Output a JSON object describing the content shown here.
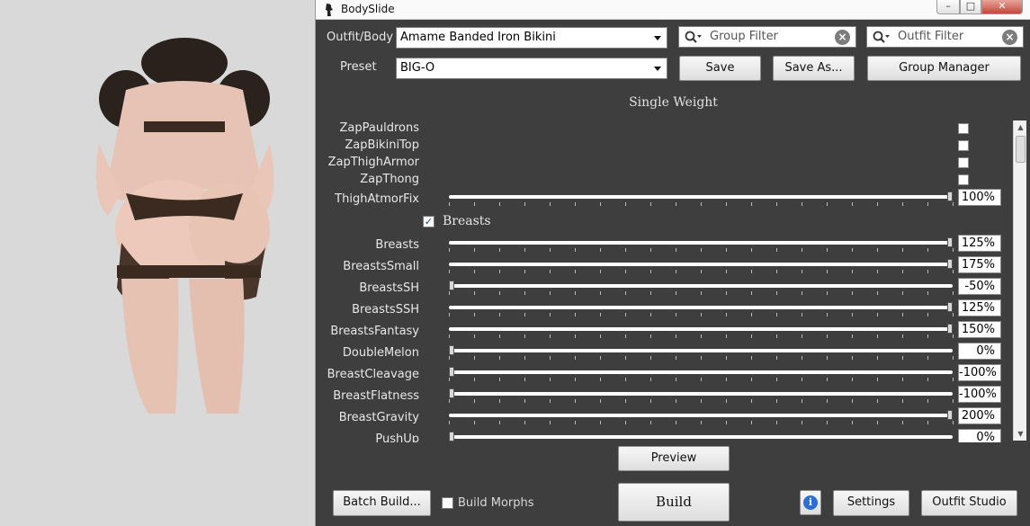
{
  "window": {
    "title": "BodySlide"
  },
  "header": {
    "outfit_label": "Outfit/Body",
    "outfit_value": "Amame Banded Iron Bikini",
    "preset_label": "Preset",
    "preset_value": "BIG-O",
    "group_filter_placeholder": "Group Filter",
    "outfit_filter_placeholder": "Outfit Filter",
    "save_label": "Save",
    "save_as_label": "Save As...",
    "group_manager_label": "Group Manager"
  },
  "single_weight_title": "Single Weight",
  "zaps": [
    {
      "label": "ZapPauldrons",
      "checked": false
    },
    {
      "label": "ZapBikiniTop",
      "checked": false
    },
    {
      "label": "ZapThighArmor",
      "checked": false
    },
    {
      "label": "ZapThong",
      "checked": false
    }
  ],
  "thigh_fix": {
    "label": "ThighAtmorFix",
    "value": "100%",
    "level": 100
  },
  "group": {
    "label": "Breasts",
    "checked": true
  },
  "sliders": [
    {
      "label": "Breasts",
      "value": "125%",
      "level": 100
    },
    {
      "label": "BreastsSmall",
      "value": "175%",
      "level": 100
    },
    {
      "label": "BreastsSH",
      "value": "-50%",
      "level": 0
    },
    {
      "label": "BreastsSSH",
      "value": "125%",
      "level": 100
    },
    {
      "label": "BreastsFantasy",
      "value": "150%",
      "level": 100
    },
    {
      "label": "DoubleMelon",
      "value": "0%",
      "level": 0
    },
    {
      "label": "BreastCleavage",
      "value": "-100%",
      "level": 0
    },
    {
      "label": "BreastFlatness",
      "value": "-100%",
      "level": 0
    },
    {
      "label": "BreastGravity",
      "value": "200%",
      "level": 100
    },
    {
      "label": "PushUp",
      "value": "0%",
      "level": 0
    }
  ],
  "footer": {
    "preview_label": "Preview",
    "batch_build_label": "Batch Build...",
    "build_morphs_label": "Build Morphs",
    "build_label": "Build",
    "settings_label": "Settings",
    "outfit_studio_label": "Outfit Studio"
  },
  "colors": {
    "panel": "#3e3e3e",
    "preview_bg": "#d9d9d9",
    "info": "#2a6fd1"
  }
}
